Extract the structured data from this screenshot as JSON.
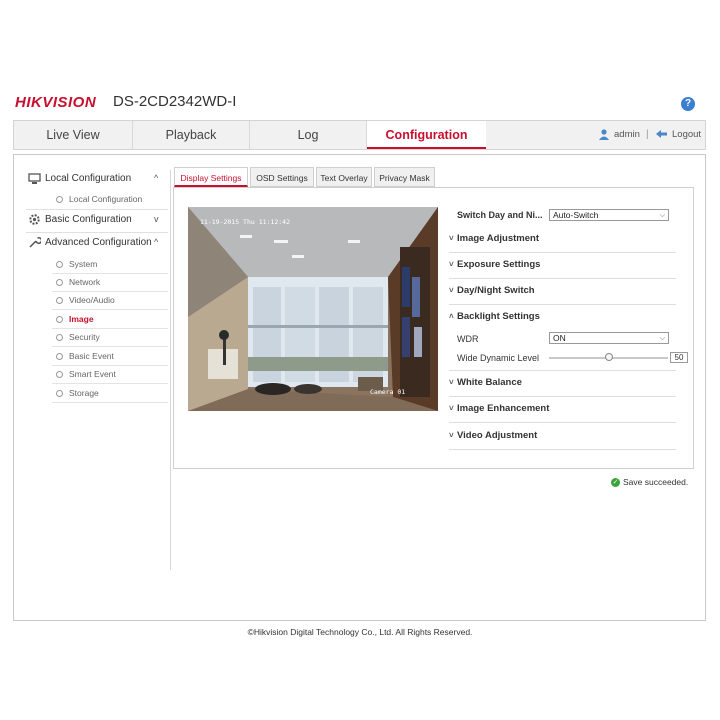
{
  "header": {
    "brand": "HIKVISION",
    "model": "DS-2CD2342WD-I",
    "help_glyph": "?"
  },
  "nav": {
    "tabs": [
      {
        "label": "Live View",
        "active": false
      },
      {
        "label": "Playback",
        "active": false
      },
      {
        "label": "Log",
        "active": false
      },
      {
        "label": "Configuration",
        "active": true
      }
    ],
    "user": "admin",
    "separator": "|",
    "logout": "Logout"
  },
  "sidebar": {
    "sections": [
      {
        "label": "Local Configuration",
        "icon": "monitor-icon",
        "chevron": "^",
        "items": [
          "Local Configuration"
        ]
      },
      {
        "label": "Basic Configuration",
        "icon": "gear-icon",
        "chevron": "v",
        "items": []
      },
      {
        "label": "Advanced Configuration",
        "icon": "wrench-icon",
        "chevron": "^",
        "items": [
          "System",
          "Network",
          "Video/Audio",
          "Image",
          "Security",
          "Basic Event",
          "Smart Event",
          "Storage"
        ],
        "active_item": "Image"
      }
    ]
  },
  "content_tabs": [
    {
      "label": "Display Settings",
      "active": true
    },
    {
      "label": "OSD Settings",
      "active": false
    },
    {
      "label": "Text Overlay",
      "active": false
    },
    {
      "label": "Privacy Mask",
      "active": false
    }
  ],
  "video": {
    "timestamp": "11-19-2015 Thu 11:12:42",
    "camera_name": "Camera 01"
  },
  "settings": {
    "switch_label": "Switch Day and Ni...",
    "switch_value": "Auto-Switch",
    "groups": {
      "image_adjustment": "Image Adjustment",
      "exposure": "Exposure Settings",
      "day_night": "Day/Night Switch",
      "backlight": "Backlight Settings",
      "white_balance": "White Balance",
      "image_enhancement": "Image Enhancement",
      "video_adjustment": "Video Adjustment"
    },
    "arrow_collapsed": "˅",
    "arrow_expanded": "˄",
    "wdr_label": "WDR",
    "wdr_value": "ON",
    "wdr_level_label": "Wide Dynamic Level",
    "wdr_level": "50",
    "wdr_level_fraction": 0.5
  },
  "status": {
    "message": "Save succeeded."
  },
  "footer": {
    "copyright": "©Hikvision Digital Technology Co., Ltd. All Rights Reserved."
  },
  "colors": {
    "accent": "#c8102e",
    "help": "#3a7fd0",
    "success": "#3aa33a"
  }
}
